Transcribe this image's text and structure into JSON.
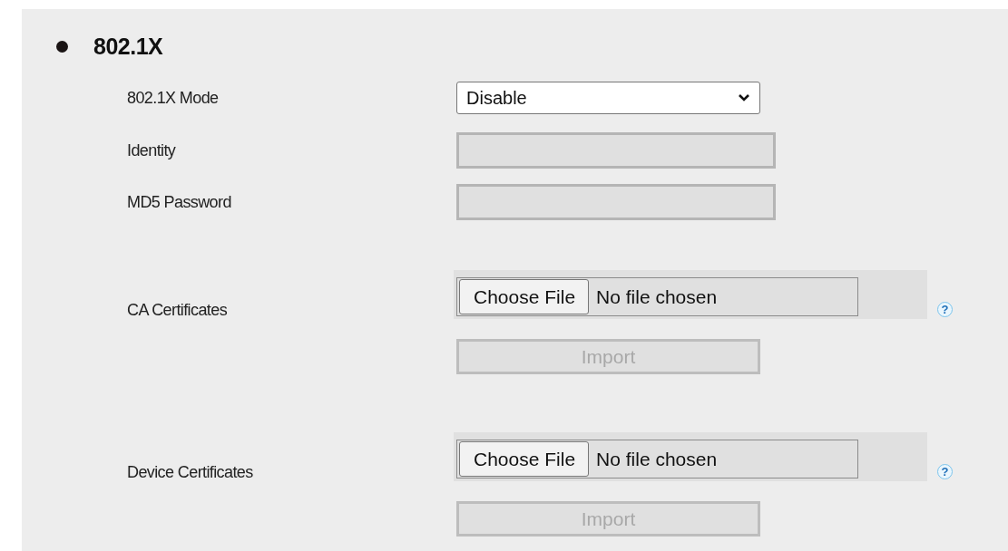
{
  "section": {
    "title": "802.1X"
  },
  "fields": [
    {
      "kind": "select",
      "label": "802.1X Mode",
      "value": "Disable"
    },
    {
      "kind": "text",
      "label": "Identity",
      "disabled": true
    },
    {
      "kind": "text",
      "label": "MD5 Password",
      "disabled": true
    },
    {
      "kind": "certificate",
      "label": "CA Certificates",
      "choose_button": "Choose File",
      "file_status": "No file chosen",
      "help": "?",
      "import_button": {
        "label": "Import",
        "disabled": true
      }
    },
    {
      "kind": "certificate",
      "label": "Device Certificates",
      "choose_button": "Choose File",
      "file_status": "No file chosen",
      "help": "?",
      "import_button": {
        "label": "Import",
        "disabled": true
      }
    }
  ]
}
